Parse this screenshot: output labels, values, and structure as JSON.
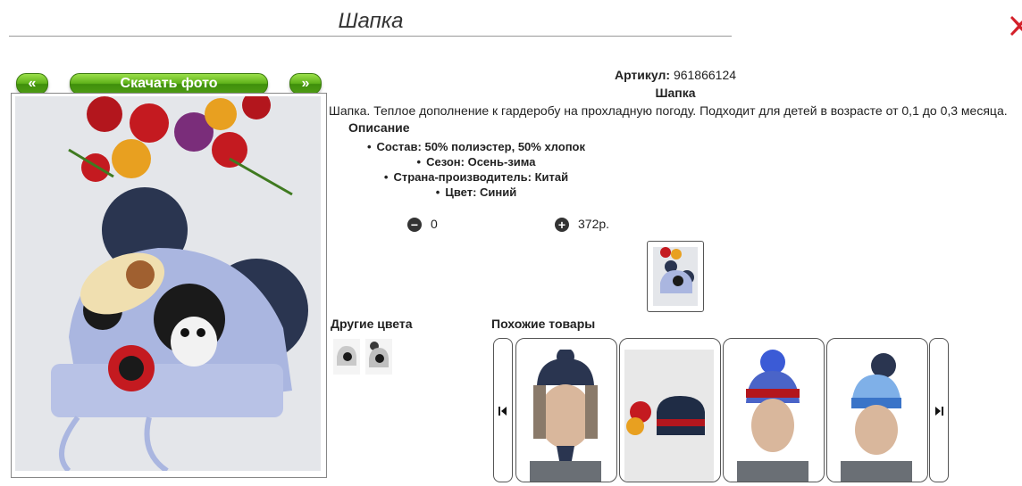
{
  "header": {
    "title": "Шапка"
  },
  "buttons": {
    "prev": "«",
    "download": "Скачать фото",
    "next": "»"
  },
  "product": {
    "article_label": "Артикул:",
    "article_value": "961866124",
    "name": "Шапка",
    "description": "Шапка. Теплое дополнение к гардеробу на прохладную погоду. Подходит для детей в возрасте от 0,1 до 0,3 месяца.",
    "description_heading": "Описание",
    "specs": [
      "Состав: 50% полиэстер, 50% хлопок",
      "Сезон: Осень-зима",
      "Страна-производитель: Китай",
      "Цвет: Синий"
    ],
    "quantity": "0",
    "price": "372р."
  },
  "sections": {
    "other_colors": "Другие цвета",
    "similar": "Похожие товары"
  },
  "colors": {
    "accent_green": "#5fb21a",
    "hat_blue": "#aab6e0",
    "pompom": "#2a3550",
    "close_red": "#d4202a"
  },
  "icons": {
    "close": "close-x-icon",
    "minus": "minus-circle-icon",
    "plus": "plus-circle-icon",
    "left": "prev-arrow-icon",
    "right": "next-arrow-icon"
  }
}
